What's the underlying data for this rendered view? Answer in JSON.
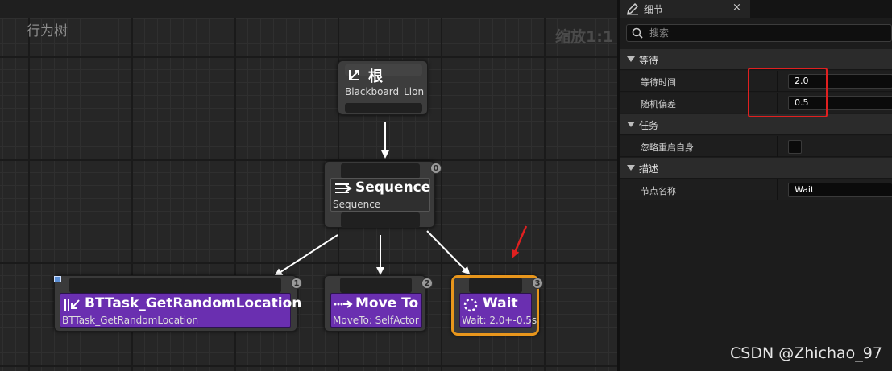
{
  "graph": {
    "title": "行为树",
    "zoom": "缩放1:1",
    "nodes": {
      "root": {
        "title": "根",
        "subtitle": "Blackboard_Lion",
        "icon": "root-branch-icon"
      },
      "sequence": {
        "title": "Sequence",
        "subtitle": "Sequence",
        "icon": "sequence-icon",
        "index": "0"
      },
      "task1": {
        "title": "BTTask_GetRandomLocation",
        "subtitle": "BTTask_GetRandomLocation",
        "icon": "task-arrow-icon",
        "index": "1"
      },
      "task2": {
        "title": "Move To",
        "subtitle": "MoveTo: SelfActor",
        "icon": "move-to-icon",
        "index": "2"
      },
      "task3": {
        "title": "Wait",
        "subtitle": "Wait: 2.0+-0.5s",
        "icon": "wait-spinner-icon",
        "index": "3"
      }
    }
  },
  "details": {
    "tab_label": "细节",
    "close": "×",
    "search_placeholder": "搜索",
    "categories": [
      {
        "label": "等待",
        "props": [
          {
            "label": "等待时间",
            "value": "2.0"
          },
          {
            "label": "随机偏差",
            "value": "0.5"
          }
        ]
      },
      {
        "label": "任务",
        "props": [
          {
            "label": "忽略重启自身",
            "checked": false
          }
        ]
      },
      {
        "label": "描述",
        "props": [
          {
            "label": "节点名称",
            "value": "Wait"
          }
        ]
      }
    ]
  },
  "watermark": "CSDN @Zhichao_97",
  "colors": {
    "task_purple": "#6a2fb0",
    "selected_orange": "#e8961c",
    "highlight_red": "#e02020"
  }
}
